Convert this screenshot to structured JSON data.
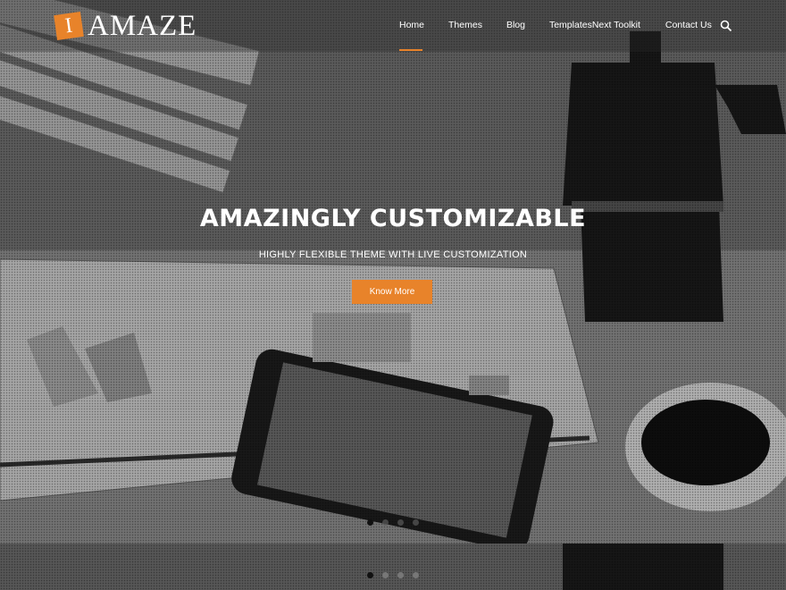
{
  "header": {
    "logo_mark": "I",
    "logo_text": "AMAZE"
  },
  "nav": {
    "items": [
      "Home",
      "Themes",
      "Blog",
      "TemplatesNext Toolkit",
      "Contact Us"
    ],
    "active": "Home",
    "search_icon": "search-icon"
  },
  "hero": {
    "title": "AMAZINGLY CUSTOMIZABLE",
    "subtitle": "HIGHLY FLEXIBLE THEME WITH LIVE CUSTOMIZATION",
    "button_label": "Know More"
  },
  "slider": {
    "slide_count": 4,
    "active_index": 1
  },
  "colors": {
    "accent": "#e8832a",
    "text": "#ffffff"
  }
}
